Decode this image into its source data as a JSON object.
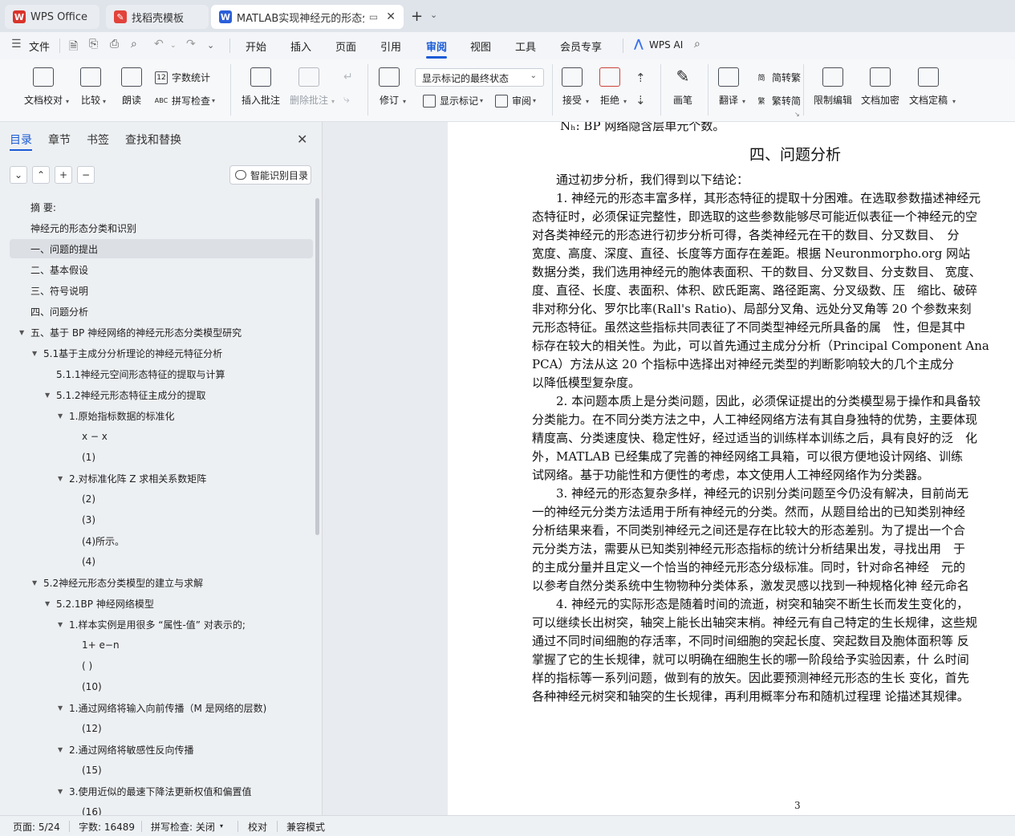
{
  "tabs": [
    {
      "label": "WPS Office"
    },
    {
      "label": "找稻壳模板"
    },
    {
      "label": "MATLAB实现神经元的形态分类"
    }
  ],
  "menu": {
    "file": "文件",
    "items": [
      "开始",
      "插入",
      "页面",
      "引用",
      "审阅",
      "视图",
      "工具",
      "会员专享"
    ],
    "active": "审阅",
    "wps_ai": "WPS AI"
  },
  "ribbon": {
    "doc_check": "文档校对",
    "compare": "比较",
    "read_aloud": "朗读",
    "word_count": "字数统计",
    "spell_check": "拼写检查",
    "insert_comment": "插入批注",
    "delete_comment": "删除批注",
    "revise": "修订",
    "markup_dropdown": "显示标记的最终状态",
    "show_markup": "显示标记",
    "review": "审阅",
    "accept": "接受",
    "reject": "拒绝",
    "pen": "画笔",
    "translate": "翻译",
    "to_traditional": "简转繁",
    "to_simplified": "繁转简",
    "restrict_edit": "限制编辑",
    "doc_encrypt": "文档加密",
    "doc_finalize": "文档定稿"
  },
  "nav": {
    "tabs": [
      "目录",
      "章节",
      "书签",
      "查找和替换"
    ],
    "smart_btn": "智能识别目录",
    "toc": [
      {
        "text": "摘 要:",
        "level": 0,
        "tri": ""
      },
      {
        "text": "神经元的形态分类和识别",
        "level": 0,
        "tri": ""
      },
      {
        "text": "一、问题的提出",
        "level": 0,
        "tri": "",
        "selected": true
      },
      {
        "text": "二、基本假设",
        "level": 0,
        "tri": ""
      },
      {
        "text": "三、符号说明",
        "level": 0,
        "tri": ""
      },
      {
        "text": "四、问题分析",
        "level": 0,
        "tri": ""
      },
      {
        "text": "五、基于 BP 神经网络的神经元形态分类模型研究",
        "level": 0,
        "tri": "▼"
      },
      {
        "text": "5.1基于主成分分析理论的神经元特征分析",
        "level": 1,
        "tri": "▼"
      },
      {
        "text": "5.1.1神经元空间形态特征的提取与计算",
        "level": 2,
        "tri": ""
      },
      {
        "text": "5.1.2神经元形态特征主成分的提取",
        "level": 2,
        "tri": "▼"
      },
      {
        "text": "1.原始指标数据的标准化",
        "level": 3,
        "tri": "▼"
      },
      {
        "text": "x − x",
        "level": 4,
        "tri": ""
      },
      {
        "text": "(1)",
        "level": 4,
        "tri": ""
      },
      {
        "text": "2.对标准化阵 Z 求相关系数矩阵",
        "level": 3,
        "tri": "▼"
      },
      {
        "text": "(2)",
        "level": 4,
        "tri": ""
      },
      {
        "text": "(3)",
        "level": 4,
        "tri": ""
      },
      {
        "text": "(4)所示。",
        "level": 4,
        "tri": ""
      },
      {
        "text": "(4)",
        "level": 4,
        "tri": ""
      },
      {
        "text": "5.2神经元形态分类模型的建立与求解",
        "level": 1,
        "tri": "▼"
      },
      {
        "text": "5.2.1BP 神经网络模型",
        "level": 2,
        "tri": "▼"
      },
      {
        "text": "1.样本实例是用很多 “属性-值” 对表示的;",
        "level": 3,
        "tri": "▼"
      },
      {
        "text": "1+ e−n",
        "level": 4,
        "tri": ""
      },
      {
        "text": "( )",
        "level": 4,
        "tri": ""
      },
      {
        "text": "(10)",
        "level": 4,
        "tri": ""
      },
      {
        "text": "1.通过网络将输入向前传播（M 是网络的层数)",
        "level": 3,
        "tri": "▼"
      },
      {
        "text": "(12)",
        "level": 4,
        "tri": ""
      },
      {
        "text": "2.通过网络将敏感性反向传播",
        "level": 3,
        "tri": "▼"
      },
      {
        "text": "(15)",
        "level": 4,
        "tri": ""
      },
      {
        "text": "3.使用近似的最速下降法更新权值和偏置值",
        "level": 3,
        "tri": "▼"
      },
      {
        "text": "(16)",
        "level": 4,
        "tri": ""
      }
    ]
  },
  "document": {
    "top_line": "Nₕ: BP 网络隐含层单元个数。",
    "heading": "四、问题分析",
    "lines": [
      "　　通过初步分析，我们得到以下结论：",
      "　　1. 神经元的形态丰富多样，其形态特征的提取十分困难。在选取参数描述神经元",
      "态特征时，必须保证完整性，即选取的这些参数能够尽可能近似表征一个神经元的空",
      "对各类神经元的形态进行初步分析可得，各类神经元在干的数目、分叉数目、　分",
      "宽度、高度、深度、直径、长度等方面存在差距。根据 Neuronmorpho.org 网站",
      "数据分类，我们选用神经元的胞体表面积、干的数目、分叉数目、分支数目、 宽度、",
      "度、直径、长度、表面积、体积、欧氏距离、路径距离、分叉级数、压　缩比、破碎",
      "非对称分化、罗尔比率(Rall's Ratio)、局部分叉角、远处分叉角等 20 个参数来刻",
      "元形态特征。虽然这些指标共同表征了不同类型神经元所具备的属　性，但是其中",
      "标存在较大的相关性。为此，可以首先通过主成分分析（Principal Component Ana",
      "PCA）方法从这 20 个指标中选择出对神经元类型的判断影响较大的几个主成分",
      "以降低模型复杂度。",
      "　　2. 本问题本质上是分类问题，因此，必须保证提出的分类模型易于操作和具备较",
      "分类能力。在不同分类方法之中，人工神经网络方法有其自身独特的优势，主要体现",
      "精度高、分类速度快、稳定性好，经过适当的训练样本训练之后，具有良好的泛　化",
      "外，MATLAB 已经集成了完善的神经网络工具箱，可以很方便地设计网络、训练",
      "试网络。基于功能性和方便性的考虑，本文使用人工神经网络作为分类器。",
      "　　3. 神经元的形态复杂多样，神经元的识别分类问题至今仍没有解决，目前尚无",
      "一的神经元分类方法适用于所有神经元的分类。然而，从题目给出的已知类别神经",
      "分析结果来看，不同类别神经元之间还是存在比较大的形态差别。为了提出一个合",
      "元分类方法，需要从已知类别神经元形态指标的统计分析结果出发，寻找出用　于",
      "的主成分量并且定义一个恰当的神经元形态分级标准。同时，针对命名神经　元的",
      "以参考自然分类系统中生物物种分类体系，激发灵感以找到一种规格化神 经元命名",
      "　　4. 神经元的实际形态是随着时间的流逝，树突和轴突不断生长而发生变化的，",
      "可以继续长出树突，轴突上能长出轴突末梢。神经元有自己特定的生长规律，这些规",
      "通过不同时间细胞的存活率，不同时间细胞的突起长度、突起数目及胞体面积等 反",
      "掌握了它的生长规律，就可以明确在细胞生长的哪一阶段给予实验因素，什 么时间",
      "样的指标等一系列问题，做到有的放矢。因此要预测神经元形态的生长 变化，首先",
      "各种神经元树突和轴突的生长规律，再利用概率分布和随机过程理 论描述其规律。"
    ],
    "page_number": "3"
  },
  "status": {
    "page": "页面: 5/24",
    "words": "字数: 16489",
    "spell": "拼写检查: 关闭",
    "proof": "校对",
    "compat": "兼容模式"
  },
  "colors": {
    "accent": "#1a5bd6",
    "wps_red": "#d9342b",
    "word_blue": "#2b5fd9"
  }
}
